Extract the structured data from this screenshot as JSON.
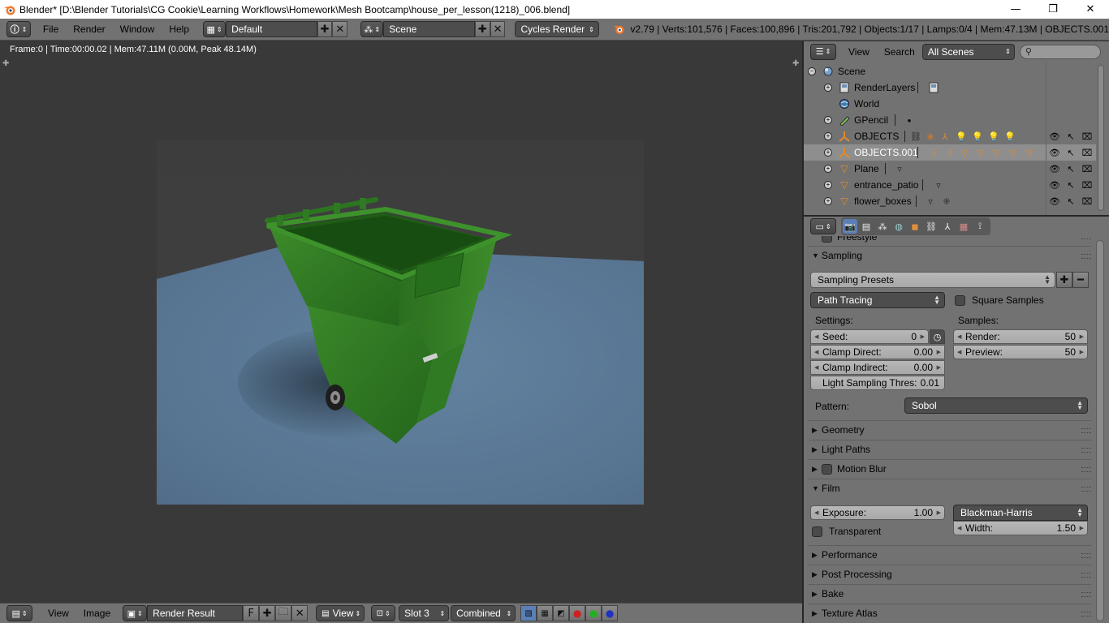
{
  "window": {
    "title": "Blender* [D:\\Blender Tutorials\\CG Cookie\\Learning Workflows\\Homework\\Mesh Bootcamp\\house_per_lesson(1218)_006.blend]",
    "minimize": "—",
    "maximize": "❐",
    "close": "✕"
  },
  "topbar": {
    "menus": [
      "File",
      "Render",
      "Window",
      "Help"
    ],
    "screen_layout": "Default",
    "scene": "Scene",
    "render_engine": "Cycles Render",
    "stats": "v2.79 | Verts:101,576 | Faces:100,896 | Tris:201,792 | Objects:1/17 | Lamps:0/4 | Mem:47.13M | OBJECTS.001"
  },
  "viewport": {
    "info": "Frame:0 | Time:00:00.02 | Mem:47.11M (0.00M, Peak 48.14M)"
  },
  "bottombar": {
    "menus": [
      "View",
      "Image"
    ],
    "image_name": "Render Result",
    "fake_user": "F",
    "view_menu": "View",
    "slot": "Slot 3",
    "pass": "Combined"
  },
  "outliner": {
    "menus": [
      "View",
      "Search"
    ],
    "display_mode": "All Scenes",
    "items": [
      {
        "label": "Scene"
      },
      {
        "label": "RenderLayers"
      },
      {
        "label": "World"
      },
      {
        "label": "GPencil"
      },
      {
        "label": "OBJECTS"
      },
      {
        "label": "OBJECTS.001"
      },
      {
        "label": "Plane"
      },
      {
        "label": "entrance_patio"
      },
      {
        "label": "flower_boxes"
      }
    ]
  },
  "properties": {
    "freestyle_partial": "Freestyle",
    "sampling": {
      "title": "Sampling",
      "presets": "Sampling Presets",
      "integrator": "Path Tracing",
      "square_samples": "Square Samples",
      "settings_label": "Settings:",
      "samples_label": "Samples:",
      "seed": {
        "label": "Seed:",
        "value": "0"
      },
      "clamp_direct": {
        "label": "Clamp Direct:",
        "value": "0.00"
      },
      "clamp_indirect": {
        "label": "Clamp Indirect:",
        "value": "0.00"
      },
      "light_sampling": {
        "label": "Light Sampling Thres:",
        "value": "0.01"
      },
      "render": {
        "label": "Render:",
        "value": "50"
      },
      "preview": {
        "label": "Preview:",
        "value": "50"
      },
      "pattern_label": "Pattern:",
      "pattern": "Sobol"
    },
    "geometry": "Geometry",
    "light_paths": "Light Paths",
    "motion_blur": "Motion Blur",
    "film": {
      "title": "Film",
      "exposure": {
        "label": "Exposure:",
        "value": "1.00"
      },
      "filter": "Blackman-Harris",
      "transparent": "Transparent",
      "width": {
        "label": "Width:",
        "value": "1.50"
      }
    },
    "performance": "Performance",
    "post_processing": "Post Processing",
    "bake": "Bake",
    "texture_atlas": "Texture Atlas"
  },
  "colors": {
    "panel_bg": "#727272",
    "viewport_bg": "#393939",
    "bin_green": "#2f7a22",
    "floor_blue": "#5a7590",
    "selection": "#8e8e8e"
  }
}
